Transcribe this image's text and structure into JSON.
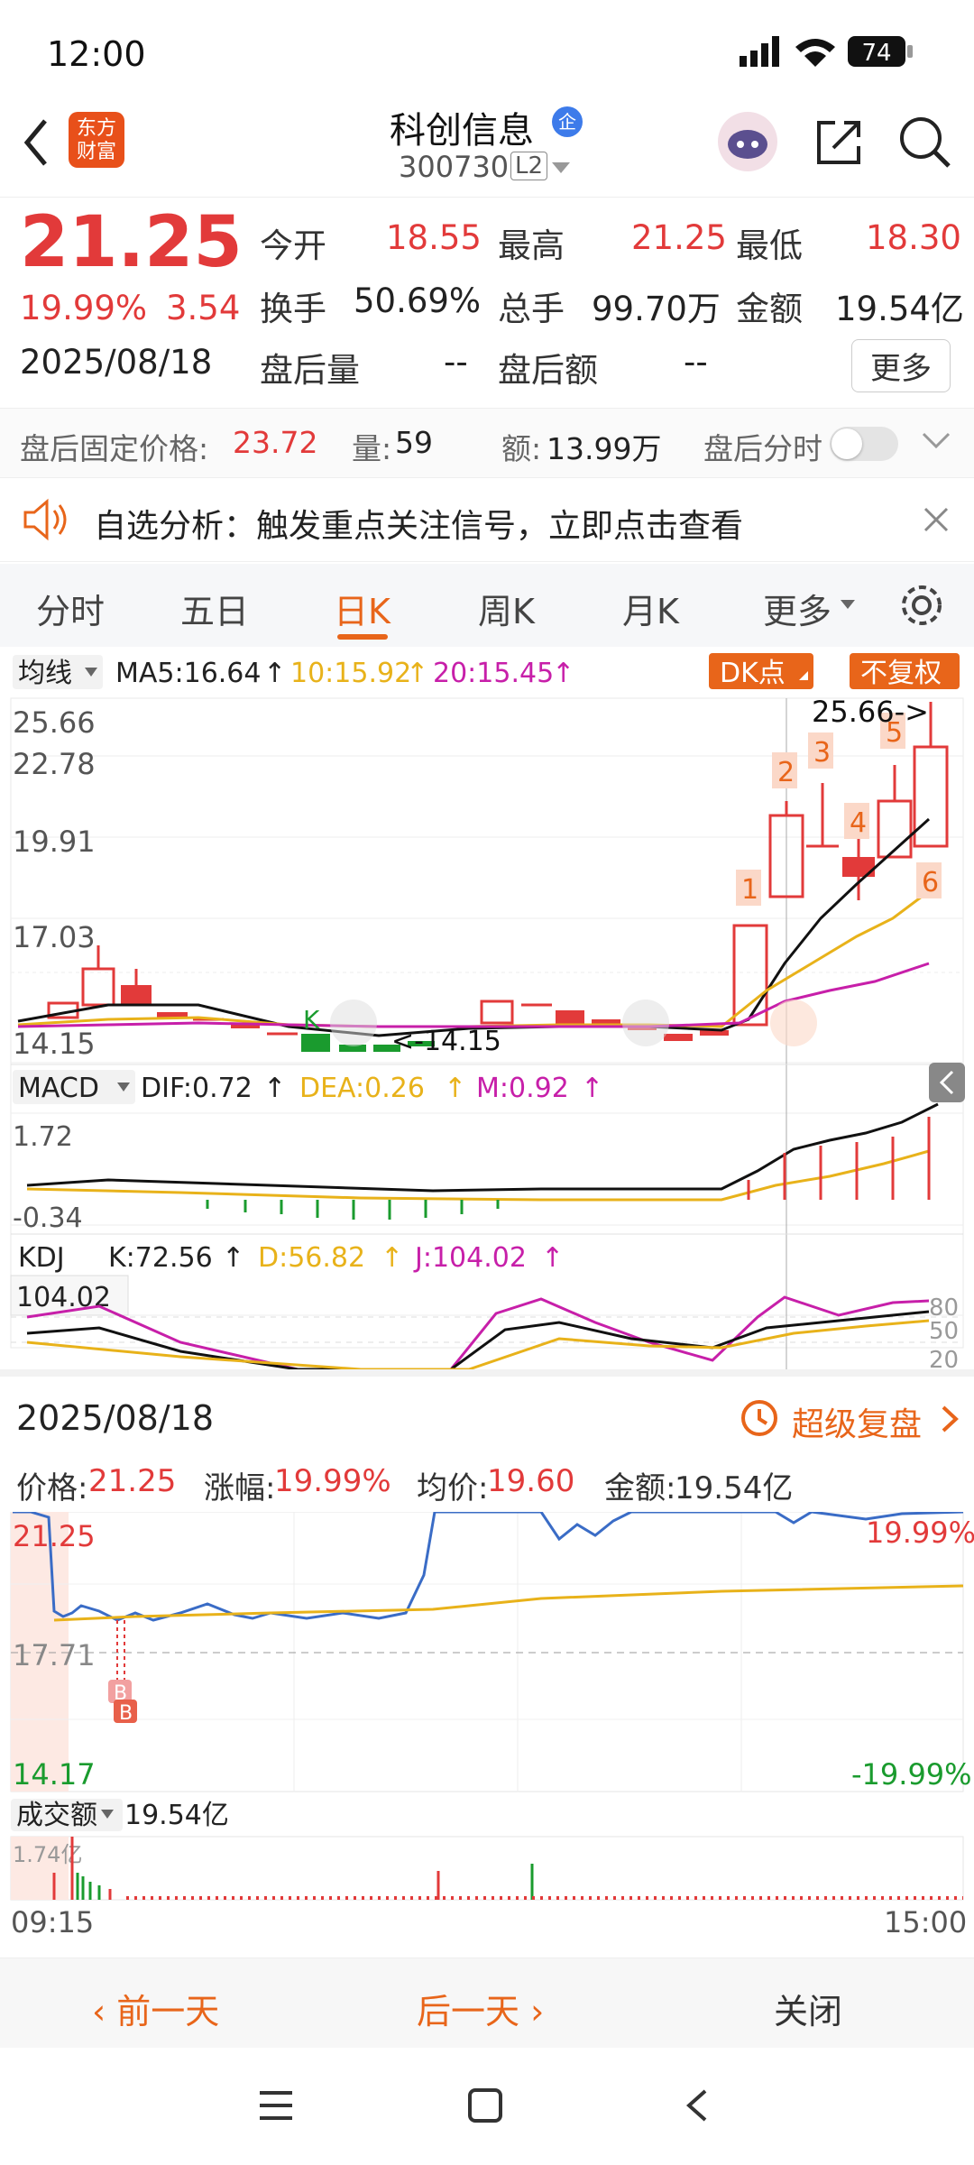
{
  "status": {
    "time": "12:00",
    "battery": "74"
  },
  "header": {
    "title": "科创信息",
    "badge": "企",
    "code": "300730",
    "level": "L2",
    "logo_line1": "东方",
    "logo_line2": "财富"
  },
  "quote": {
    "price": "21.25",
    "pct": "19.99%",
    "change": "3.54",
    "date": "2025/08/18",
    "open_label": "今开",
    "open": "18.55",
    "high_label": "最高",
    "high": "21.25",
    "low_label": "最低",
    "low": "18.30",
    "turnover_label": "换手",
    "turnover": "50.69%",
    "volume_label": "总手",
    "volume": "99.70万",
    "amount_label": "金额",
    "amount": "19.54亿",
    "after_vol_label": "盘后量",
    "after_vol": "--",
    "after_amt_label": "盘后额",
    "after_amt": "--",
    "more_button": "更多"
  },
  "after_hours": {
    "price_label": "盘后固定价格:",
    "price": "23.72",
    "vol_label": "量:",
    "vol": "59",
    "amt_label": "额:",
    "amt": "13.99万",
    "toggle_label": "盘后分时"
  },
  "notice": {
    "text": "自选分析：触发重点关注信号，立即点击查看"
  },
  "tabs": [
    "分时",
    "五日",
    "日K",
    "周K",
    "月K",
    "更多"
  ],
  "active_tab": "日K",
  "kline": {
    "indicator": "均线",
    "ma5": "MA5:16.64",
    "ma10": "10:15.92",
    "ma20": "20:15.45",
    "dk_button": "DK点",
    "fq_button": "不复权",
    "y_labels": [
      "25.66",
      "22.78",
      "19.91",
      "17.03",
      "14.15"
    ],
    "high_marker": "25.66->",
    "low_marker": "<-14.15",
    "markers": [
      "1",
      "2",
      "3",
      "4",
      "5",
      "6"
    ],
    "k_mark": "K"
  },
  "macd": {
    "name": "MACD",
    "dif": "DIF:0.72",
    "dea": "DEA:0.26",
    "m": "M:0.92",
    "y_top": "1.72",
    "y_bottom": "-0.34"
  },
  "kdj": {
    "name": "KDJ",
    "k": "K:72.56",
    "d": "D:56.82",
    "j": "J:104.02",
    "y_left": "104.02",
    "levels": [
      "80",
      "50",
      "20"
    ]
  },
  "intraday": {
    "date": "2025/08/18",
    "review_button": "超级复盘",
    "price_label": "价格:",
    "price": "21.25",
    "change_label": "涨幅:",
    "change": "19.99%",
    "avg_label": "均价:",
    "avg": "19.60",
    "amount_label": "金额:",
    "amount": "19.54亿",
    "y_top": "21.25",
    "y_mid": "17.71",
    "y_bottom": "14.17",
    "pct_top": "19.99%",
    "pct_bottom": "-19.99%",
    "volume_label": "成交额",
    "volume_value": "19.54亿",
    "vol_axis": "1.74亿",
    "time_start": "09:15",
    "time_end": "15:00",
    "trade_mark_1": "B",
    "trade_mark_2": "B"
  },
  "bottom_nav": {
    "prev": "前一天",
    "next": "后一天",
    "close": "关闭"
  },
  "colors": {
    "up": "#e23a3a",
    "down": "#1a9b2e",
    "accent": "#e8651a",
    "ma10": "#e8b21a",
    "ma20": "#c71fa9"
  }
}
